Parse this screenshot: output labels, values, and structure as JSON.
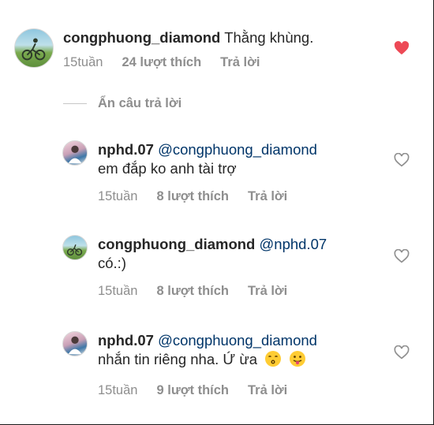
{
  "main_comment": {
    "username": "congphuong_diamond",
    "text": "Thằng khùng.",
    "time": "15tuần",
    "likes": "24 lượt thích",
    "reply": "Trả lời",
    "liked": true
  },
  "hide_replies": "Ẩn câu trả lời",
  "replies": [
    {
      "username": "nphd.07",
      "mention": "@congphuong_diamond",
      "text": "em đắp ko anh tài trợ",
      "time": "15tuần",
      "likes": "8 lượt thích",
      "reply": "Trả lời"
    },
    {
      "username": "congphuong_diamond",
      "mention": "@nphd.07",
      "text": "có.:)",
      "time": "15tuần",
      "likes": "8 lượt thích",
      "reply": "Trả lời"
    },
    {
      "username": "nphd.07",
      "mention": "@congphuong_diamond",
      "text": "nhắn tin riêng nha. Ứ ừa",
      "emojis": [
        "kissing-face",
        "tongue-out-face"
      ],
      "time": "15tuần",
      "likes": "9 lượt thích",
      "reply": "Trả lời"
    }
  ],
  "colors": {
    "heart_liked": "#ed4956",
    "muted_text": "#8e8e8e",
    "mention": "#003569"
  }
}
